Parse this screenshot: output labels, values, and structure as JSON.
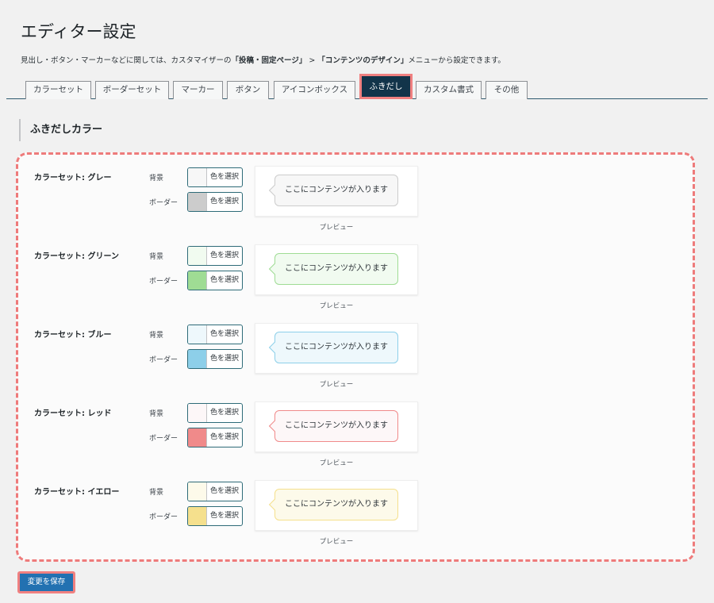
{
  "page": {
    "title": "エディター設定",
    "description": {
      "part1": "見出し・ボタン・マーカーなどに関しては、カスタマイザーの",
      "link1": "「投稿・固定ページ」",
      "sep": " > ",
      "link2": "「コンテンツのデザイン」",
      "part2": "メニューから設定できます。"
    }
  },
  "tabs": [
    {
      "label": "カラーセット",
      "active": false
    },
    {
      "label": "ボーダーセット",
      "active": false
    },
    {
      "label": "マーカー",
      "active": false
    },
    {
      "label": "ボタン",
      "active": false
    },
    {
      "label": "アイコンボックス",
      "active": false
    },
    {
      "label": "ふきだし",
      "active": true
    },
    {
      "label": "カスタム書式",
      "active": false
    },
    {
      "label": "その他",
      "active": false
    }
  ],
  "section": {
    "title": "ふきだしカラー"
  },
  "color_sets": [
    {
      "title": "カラーセット: グレー",
      "bg_label": "背景",
      "border_label": "ボーダー",
      "button_label": "色を選択",
      "bg_color": "#f7f7f7",
      "border_color": "#cccccc",
      "preview_text": "ここにコンテンツが入ります",
      "preview_caption": "プレビュー"
    },
    {
      "title": "カラーセット: グリーン",
      "bg_label": "背景",
      "border_label": "ボーダー",
      "button_label": "色を選択",
      "bg_color": "#f1fbf0",
      "border_color": "#9fdc94",
      "preview_text": "ここにコンテンツが入ります",
      "preview_caption": "プレビュー"
    },
    {
      "title": "カラーセット: ブルー",
      "bg_label": "背景",
      "border_label": "ボーダー",
      "button_label": "色を選択",
      "bg_color": "#eef8fc",
      "border_color": "#8dcfe9",
      "preview_text": "ここにコンテンツが入ります",
      "preview_caption": "プレビュー"
    },
    {
      "title": "カラーセット: レッド",
      "bg_label": "背景",
      "border_label": "ボーダー",
      "button_label": "色を選択",
      "bg_color": "#fdf7f8",
      "border_color": "#f08a8a",
      "preview_text": "ここにコンテンツが入ります",
      "preview_caption": "プレビュー"
    },
    {
      "title": "カラーセット: イエロー",
      "bg_label": "背景",
      "border_label": "ボーダー",
      "button_label": "色を選択",
      "bg_color": "#fdfaea",
      "border_color": "#f5e08d",
      "preview_text": "ここにコンテンツが入ります",
      "preview_caption": "プレビュー"
    }
  ],
  "save_button": {
    "label": "変更を保存"
  },
  "colors": {
    "active_tab_bg": "#12344a",
    "highlight": "#f08080",
    "primary": "#2271b1"
  }
}
